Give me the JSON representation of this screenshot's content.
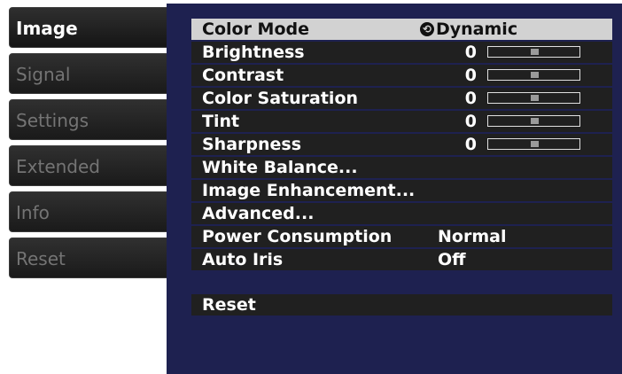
{
  "tabs": [
    {
      "label": "Image",
      "selected": true
    },
    {
      "label": "Signal",
      "selected": false
    },
    {
      "label": "Settings",
      "selected": false
    },
    {
      "label": "Extended",
      "selected": false
    },
    {
      "label": "Info",
      "selected": false
    },
    {
      "label": "Reset",
      "selected": false
    }
  ],
  "menu": {
    "color_mode": {
      "label": "Color Mode",
      "value": "Dynamic"
    },
    "brightness": {
      "label": "Brightness",
      "value": "0",
      "level": 0.5
    },
    "contrast": {
      "label": "Contrast",
      "value": "0",
      "level": 0.5
    },
    "color_saturation": {
      "label": "Color Saturation",
      "value": "0",
      "level": 0.5
    },
    "tint": {
      "label": "Tint",
      "value": "0",
      "level": 0.5
    },
    "sharpness": {
      "label": "Sharpness",
      "value": "0",
      "level": 0.5
    },
    "white_balance": {
      "label": "White Balance..."
    },
    "image_enhancement": {
      "label": "Image Enhancement..."
    },
    "advanced": {
      "label": "Advanced..."
    },
    "power_consumption": {
      "label": "Power Consumption",
      "value": "Normal"
    },
    "auto_iris": {
      "label": "Auto Iris",
      "value": "Off"
    },
    "reset": {
      "label": "Reset"
    }
  },
  "colors": {
    "panel_bg": "#1e2150",
    "row_bg": "#202020",
    "selected_row_bg": "#d2d2d2",
    "tab_selected_text": "#ffffff",
    "tab_inactive_text": "#747474"
  },
  "icons": {
    "color_mode_value": "circular-arrow-icon"
  }
}
